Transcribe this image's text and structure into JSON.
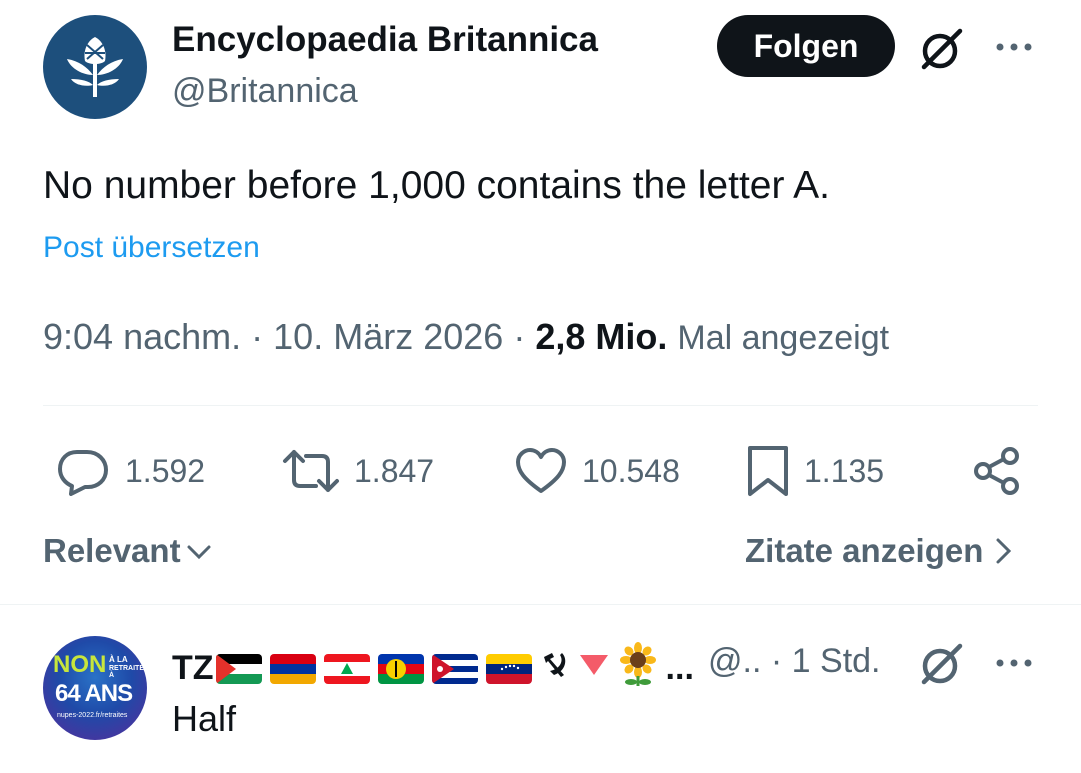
{
  "author": {
    "name": "Encyclopaedia Britannica",
    "handle": "@Britannica",
    "avatar_icon": "thistle-logo-icon",
    "avatar_color": "#1d4f7c"
  },
  "follow_label": "Folgen",
  "tweet": {
    "text": "No number before 1,000 contains the letter A.",
    "translate_label": "Post übersetzen",
    "time": "9:04 nachm.",
    "sep1": "·",
    "date": "10. März 2026",
    "sep2": "·",
    "views_count": "2,8 Mio.",
    "views_label": "Mal angezeigt"
  },
  "actions": {
    "replies": "1.592",
    "reposts": "1.847",
    "likes": "10.548",
    "bookmarks": "1.135"
  },
  "sort_label": "Relevant",
  "quotes_label": "Zitate anzeigen",
  "reply": {
    "name": "TZ",
    "name_suffix": "...",
    "handle": "@..",
    "sep": "·",
    "time": "1 Std.",
    "text": "Half",
    "avatar_text_big": "NON",
    "avatar_text_64": "64 ANS",
    "avatar_text_small1": "À LA",
    "avatar_text_small2": "RETRAITE À",
    "avatar_text_url": "nupes-2022.fr/retraites",
    "flags": [
      "palestine-flag",
      "armenia-flag",
      "lebanon-flag",
      "new-caledonia-flag",
      "cuba-flag",
      "venezuela-flag"
    ],
    "emojis": [
      "hammer-sickle-icon",
      "red-triangle-icon",
      "sunflower-icon"
    ]
  },
  "colors": {
    "text_primary": "#0f1419",
    "text_secondary": "#536471",
    "link": "#1d9bf0",
    "divider": "#eff3f4"
  }
}
